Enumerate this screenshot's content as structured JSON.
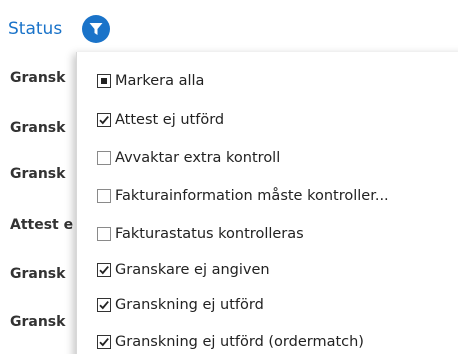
{
  "column_header": {
    "label": "Status"
  },
  "icons": {
    "filter": "filter-funnel-icon",
    "checkbox_checked": "checkmark-icon",
    "checkbox_indeterminate": "indeterminate-square-icon"
  },
  "colors": {
    "accent": "#1a73c9",
    "text": "#222222"
  },
  "table_rows": [
    {
      "status": "Gransk"
    },
    {
      "status": "Gransk"
    },
    {
      "status": "Gransk"
    },
    {
      "status": "Attest e"
    },
    {
      "status": "Gransk"
    },
    {
      "status": "Gransk"
    }
  ],
  "filter_dropdown": {
    "options": [
      {
        "label": "Markera alla",
        "state": "indeterminate"
      },
      {
        "label": "Attest ej utförd",
        "state": "checked"
      },
      {
        "label": "Avvaktar extra kontroll",
        "state": "unchecked"
      },
      {
        "label": "Fakturainformation måste kontroller...",
        "state": "unchecked"
      },
      {
        "label": "Fakturastatus kontrolleras",
        "state": "unchecked"
      },
      {
        "label": "Granskare ej angiven",
        "state": "checked"
      },
      {
        "label": "Granskning ej utförd",
        "state": "checked"
      },
      {
        "label": "Granskning ej utförd (ordermatch)",
        "state": "checked"
      }
    ]
  }
}
